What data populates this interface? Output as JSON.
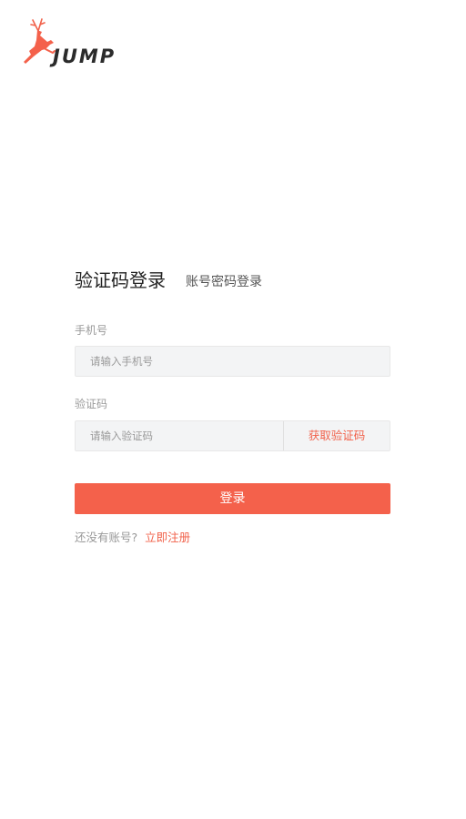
{
  "brand": {
    "logo_text": "JUMP",
    "icon": "deer-icon",
    "accent": "#f4614b"
  },
  "login": {
    "tabs": [
      {
        "label": "验证码登录",
        "active": true
      },
      {
        "label": "账号密码登录",
        "active": false
      }
    ],
    "phone": {
      "label": "手机号",
      "placeholder": "请输入手机号",
      "value": ""
    },
    "code": {
      "label": "验证码",
      "placeholder": "请输入验证码",
      "value": "",
      "get_code_label": "获取验证码"
    },
    "submit_label": "登录",
    "register_prompt": "还没有账号?",
    "register_link": "立即注册"
  }
}
